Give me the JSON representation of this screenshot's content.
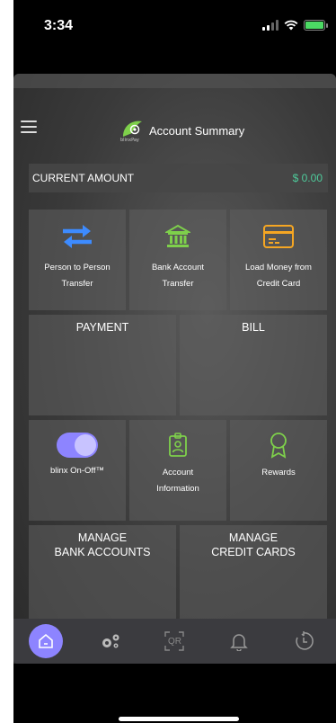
{
  "status_bar": {
    "time": "3:34"
  },
  "header": {
    "title": "Account Summary",
    "logo_text": "blinxPay"
  },
  "balance": {
    "label": "CURRENT AMOUNT",
    "value": "$ 0.00"
  },
  "tiles": {
    "p2p": {
      "line1": "Person to Person",
      "line2": "Transfer",
      "icon": "transfer-arrows-icon"
    },
    "bank": {
      "line1": "Bank Account",
      "line2": "Transfer",
      "icon": "bank-icon"
    },
    "card": {
      "line1": "Load Money from",
      "line2": "Credit Card",
      "icon": "credit-card-icon"
    },
    "payment": {
      "label": "PAYMENT"
    },
    "bill": {
      "label": "BILL"
    },
    "toggle": {
      "label": "blinx On-Off™",
      "icon": "toggle-icon"
    },
    "account": {
      "line1": "Account",
      "line2": "Information",
      "icon": "id-badge-icon"
    },
    "rewards": {
      "label": "Rewards",
      "icon": "award-icon"
    },
    "manage_bank": {
      "line1": "MANAGE",
      "line2": "BANK ACCOUNTS"
    },
    "manage_cards": {
      "line1": "MANAGE",
      "line2": "CREDIT CARDS"
    }
  },
  "bottom_nav": {
    "items": [
      "home-icon",
      "settings-gears-icon",
      "qr-icon",
      "bell-icon",
      "history-icon"
    ],
    "qr_label": "QR"
  },
  "colors": {
    "accent": "#8d84ff",
    "money": "#4ecb9b",
    "blue": "#3d8bff",
    "green": "#7ed04b",
    "orange": "#f5a623"
  }
}
